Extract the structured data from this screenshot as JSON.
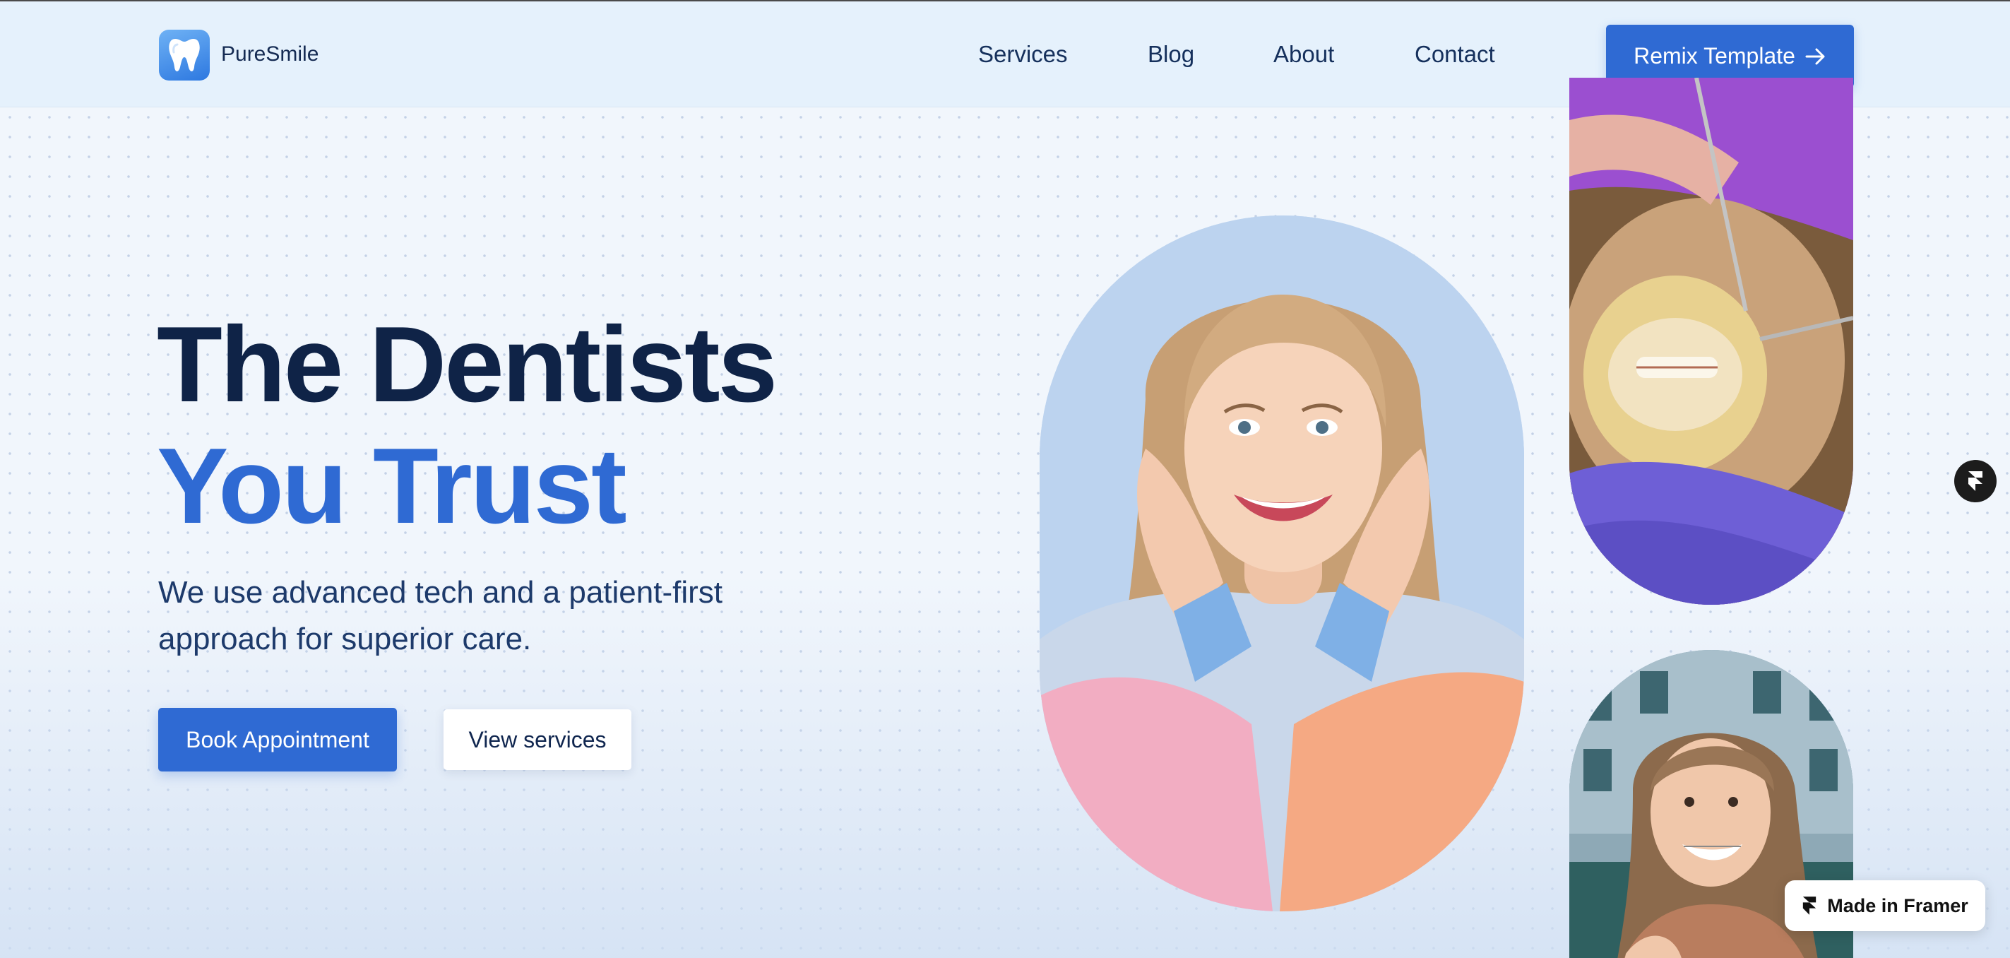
{
  "brand": {
    "name": "PureSmile",
    "logo_icon": "tooth-icon",
    "logo_color": "#3b86e8"
  },
  "nav": {
    "links": [
      {
        "label": "Services"
      },
      {
        "label": "Blog"
      },
      {
        "label": "About"
      },
      {
        "label": "Contact"
      }
    ],
    "cta_label": "Remix Template",
    "cta_icon": "arrow-right-icon"
  },
  "hero": {
    "title_line1": "The Dentists",
    "title_line2": "You Trust",
    "subtitle_line1": "We use advanced tech and a patient-first",
    "subtitle_line2": "approach for superior care.",
    "primary_button": "Book Appointment",
    "secondary_button": "View services"
  },
  "images": {
    "main": "smiling-woman-photo",
    "top": "dental-braces-procedure-photo",
    "bottom": "smiling-girl-with-braces-photo"
  },
  "framer": {
    "badge_label": "Made in Framer",
    "icon": "framer-logo-icon"
  },
  "colors": {
    "accent": "#2f6ad3",
    "heading": "#0f2347",
    "nav_bg": "#e5f1fc",
    "page_bg": "#f1f6fc"
  }
}
